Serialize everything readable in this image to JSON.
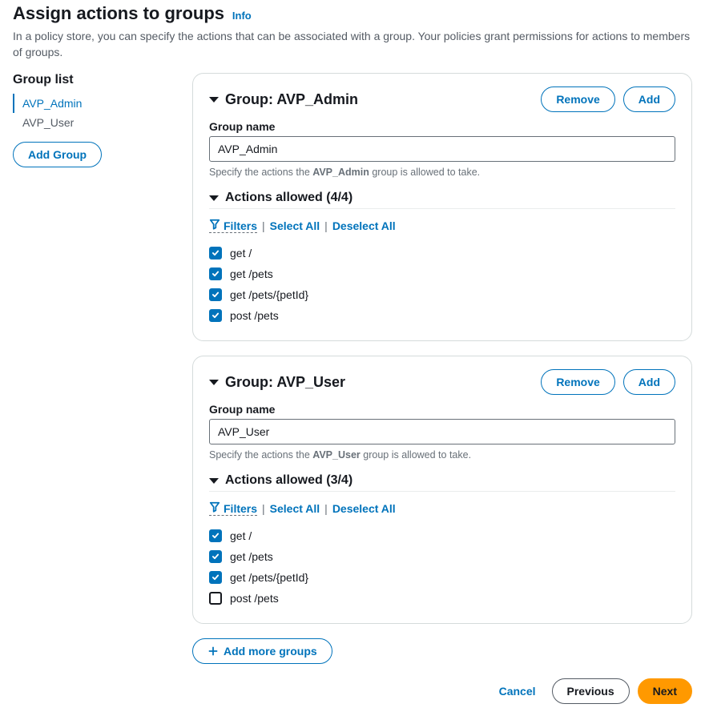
{
  "header": {
    "title": "Assign actions to groups",
    "info_label": "Info",
    "subtitle": "In a policy store, you can specify the actions that can be associated with a group. Your policies grant permissions for actions to members of groups."
  },
  "sidebar": {
    "title": "Group list",
    "items": [
      {
        "label": "AVP_Admin",
        "active": true
      },
      {
        "label": "AVP_User",
        "active": false
      }
    ],
    "add_group_label": "Add Group"
  },
  "common": {
    "remove_label": "Remove",
    "add_label": "Add",
    "group_name_label": "Group name",
    "hint_prefix": "Specify the actions the ",
    "hint_suffix": " group is allowed to take.",
    "filters_label": "Filters",
    "select_all_label": "Select All",
    "deselect_all_label": "Deselect All",
    "group_prefix": "Group: ",
    "actions_prefix": "Actions allowed "
  },
  "groups": [
    {
      "name": "AVP_Admin",
      "actions_count": "(4/4)",
      "actions": [
        {
          "label": "get /",
          "checked": true
        },
        {
          "label": "get /pets",
          "checked": true
        },
        {
          "label": "get /pets/{petId}",
          "checked": true
        },
        {
          "label": "post /pets",
          "checked": true
        }
      ]
    },
    {
      "name": "AVP_User",
      "actions_count": "(3/4)",
      "actions": [
        {
          "label": "get /",
          "checked": true
        },
        {
          "label": "get /pets",
          "checked": true
        },
        {
          "label": "get /pets/{petId}",
          "checked": true
        },
        {
          "label": "post /pets",
          "checked": false
        }
      ]
    }
  ],
  "footer": {
    "add_more_label": "Add more groups",
    "cancel_label": "Cancel",
    "previous_label": "Previous",
    "next_label": "Next"
  }
}
